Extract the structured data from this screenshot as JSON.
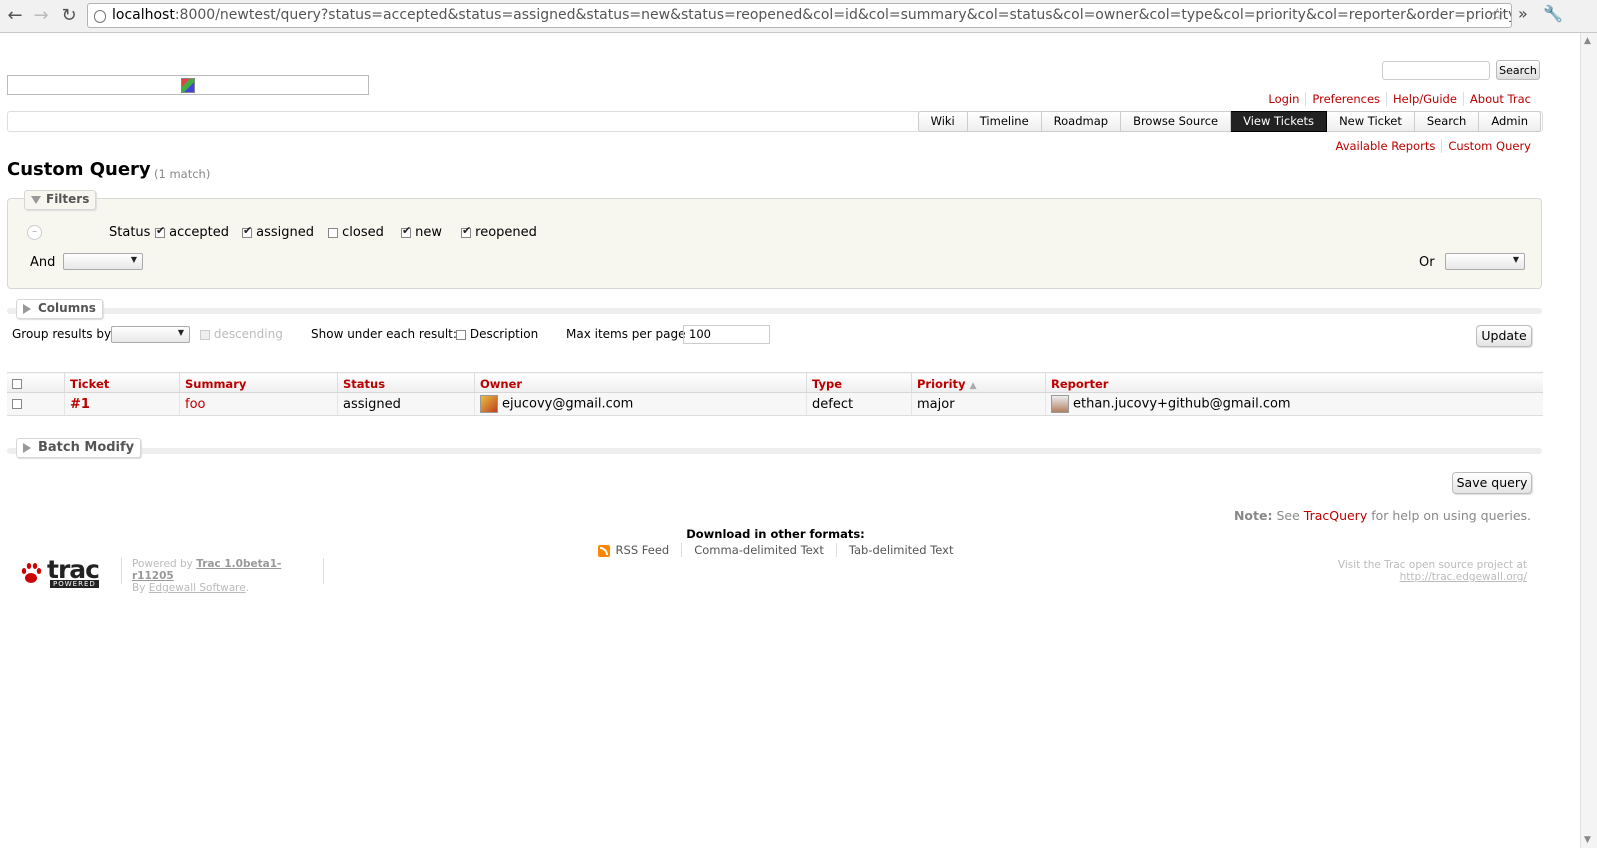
{
  "browser": {
    "url_host": "localhost",
    "url_rest": ":8000/newtest/query?status=accepted&status=assigned&status=new&status=reopened&col=id&col=summary&col=status&col=owner&col=type&col=priority&col=reporter&order=priority"
  },
  "search": {
    "button": "Search"
  },
  "metanav": [
    "Login",
    "Preferences",
    "Help/Guide",
    "About Trac"
  ],
  "mainnav": [
    {
      "label": "Wiki",
      "active": false
    },
    {
      "label": "Timeline",
      "active": false
    },
    {
      "label": "Roadmap",
      "active": false
    },
    {
      "label": "Browse Source",
      "active": false
    },
    {
      "label": "View Tickets",
      "active": true
    },
    {
      "label": "New Ticket",
      "active": false
    },
    {
      "label": "Search",
      "active": false
    },
    {
      "label": "Admin",
      "active": false
    }
  ],
  "ctxnav": [
    "Available Reports",
    "Custom Query"
  ],
  "page": {
    "title": "Custom Query",
    "matches": "(1 match)"
  },
  "filters": {
    "legend": "Filters",
    "status_label": "Status",
    "statuses": [
      {
        "label": "accepted",
        "checked": true
      },
      {
        "label": "assigned",
        "checked": true
      },
      {
        "label": "closed",
        "checked": false
      },
      {
        "label": "new",
        "checked": true
      },
      {
        "label": "reopened",
        "checked": true
      }
    ],
    "and_label": "And",
    "or_label": "Or"
  },
  "columns": {
    "legend": "Columns"
  },
  "options": {
    "group_label": "Group results by",
    "descending_label": "descending",
    "show_label": "Show under each result:",
    "description_label": "Description",
    "max_label": "Max items per page",
    "max_value": "100",
    "update_button": "Update"
  },
  "table": {
    "headers": [
      "Ticket",
      "Summary",
      "Status",
      "Owner",
      "Type",
      "Priority",
      "Reporter"
    ],
    "sort_indicator": "▲",
    "rows": [
      {
        "ticket": "#1",
        "summary": "foo",
        "status": "assigned",
        "owner": "ejucovy@gmail.com",
        "type": "defect",
        "priority": "major",
        "reporter": "ethan.jucovy+github@gmail.com"
      }
    ]
  },
  "batch": {
    "legend": "Batch Modify"
  },
  "save_button": "Save query",
  "help": {
    "note": "Note:",
    "pre": "See",
    "link": "TracQuery",
    "post": "for help on using queries."
  },
  "download": {
    "header": "Download in other formats:",
    "links": [
      "RSS Feed",
      "Comma-delimited Text",
      "Tab-delimited Text"
    ]
  },
  "footer": {
    "logo_text": "trac",
    "logo_sub": "POWERED",
    "powered_by": "Powered by",
    "version": "Trac 1.0beta1-r11205",
    "by": "By",
    "company": "Edgewall Software",
    "visit": "Visit the Trac open source project at",
    "visit_url": "http://trac.edgewall.org/"
  }
}
